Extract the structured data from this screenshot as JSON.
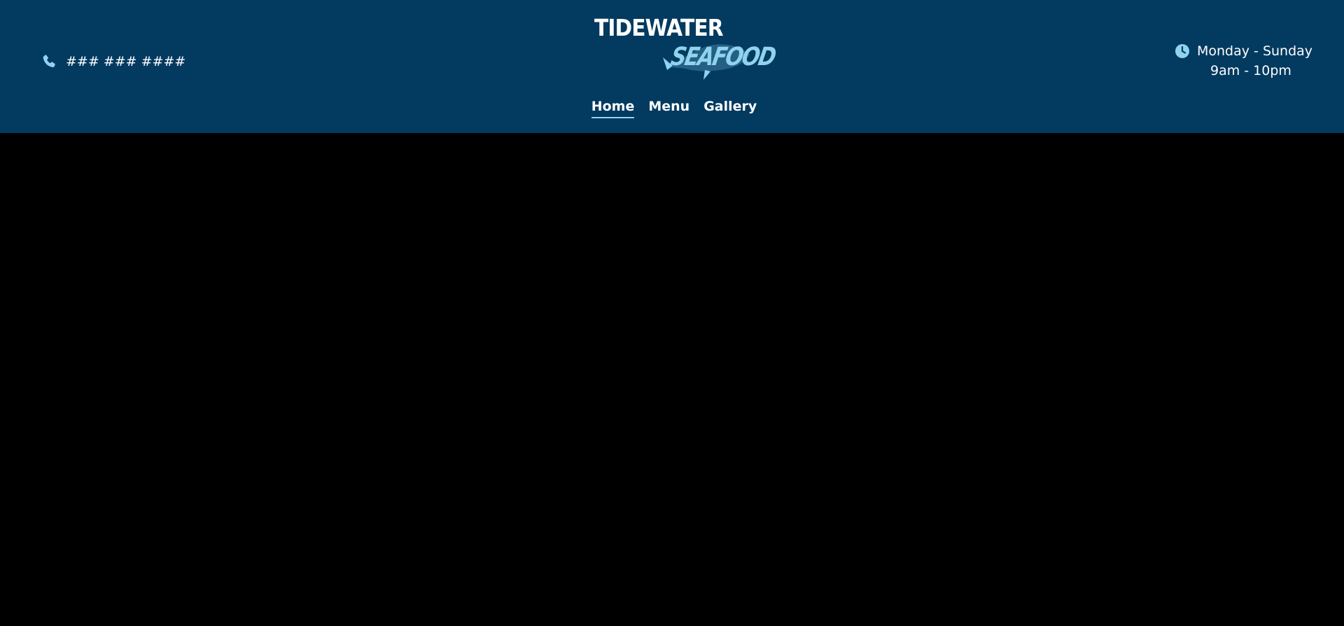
{
  "brand": {
    "name_main": "TIDEWATER",
    "name_sub": "SEAFOOD",
    "header_bg": "#023a60",
    "accent": "#8fd3ee"
  },
  "contact": {
    "phone_icon": "phone-icon",
    "phone": "### ### ####"
  },
  "nav": {
    "items": [
      {
        "label": "Home",
        "active": true
      },
      {
        "label": "Menu",
        "active": false
      },
      {
        "label": "Gallery",
        "active": false
      }
    ]
  },
  "hours": {
    "icon": "clock-icon",
    "days": "Monday - Sunday",
    "time": "9am - 10pm"
  },
  "main": {
    "bg": "#000000"
  }
}
